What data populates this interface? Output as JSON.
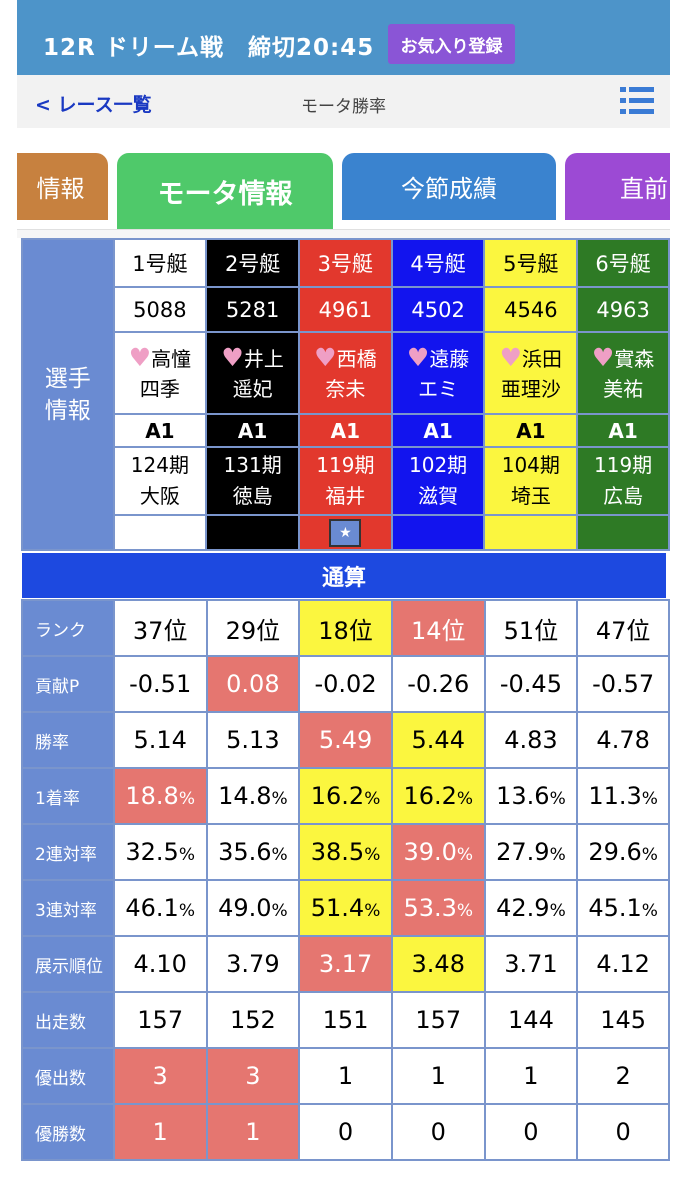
{
  "header": {
    "title": "12R ドリーム戦　締切20:45",
    "favorite_button": "お気入り登録",
    "colors": {
      "bar": "#4d94c9",
      "favorite": "#8a55d6"
    }
  },
  "subnav": {
    "back_label": "< レース一覧",
    "page_title": "モータ勝率",
    "menu_icon": "list-menu-icon"
  },
  "tabs": [
    {
      "label": "情報"
    },
    {
      "label": "モータ情報"
    },
    {
      "label": "今節成績"
    },
    {
      "label": "直前"
    }
  ],
  "player_info": {
    "side_label_1": "選手",
    "side_label_2": "情報",
    "boats": [
      {
        "label": "1号艇",
        "reg": "5088",
        "name1": "高憧",
        "name2": "四季",
        "grade": "A1",
        "term": "124期",
        "branch": "大阪"
      },
      {
        "label": "2号艇",
        "reg": "5281",
        "name1": "井上",
        "name2": "遥妃",
        "grade": "A1",
        "term": "131期",
        "branch": "徳島"
      },
      {
        "label": "3号艇",
        "reg": "4961",
        "name1": "西橋",
        "name2": "奈未",
        "grade": "A1",
        "term": "119期",
        "branch": "福井"
      },
      {
        "label": "4号艇",
        "reg": "4502",
        "name1": "遠藤",
        "name2": "エミ",
        "grade": "A1",
        "term": "102期",
        "branch": "滋賀"
      },
      {
        "label": "5号艇",
        "reg": "4546",
        "name1": "浜田",
        "name2": "亜理沙",
        "grade": "A1",
        "term": "104期",
        "branch": "埼玉"
      },
      {
        "label": "6号艇",
        "reg": "4963",
        "name1": "實森",
        "name2": "美祐",
        "grade": "A1",
        "term": "119期",
        "branch": "広島"
      }
    ],
    "star": "★"
  },
  "total_label": "通算",
  "stats": {
    "labels": [
      "ランク",
      "貢献P",
      "勝率",
      "1着率",
      "2連対率",
      "3連対率",
      "展示順位",
      "出走数",
      "優出数",
      "優勝数"
    ],
    "rows": [
      [
        "37位",
        "29位",
        "18位",
        "14位",
        "51位",
        "47位"
      ],
      [
        "-0.51",
        "0.08",
        "-0.02",
        "-0.26",
        "-0.45",
        "-0.57"
      ],
      [
        "5.14",
        "5.13",
        "5.49",
        "5.44",
        "4.83",
        "4.78"
      ],
      [
        "18.8",
        "14.8",
        "16.2",
        "16.2",
        "13.6",
        "11.3"
      ],
      [
        "32.5",
        "35.6",
        "38.5",
        "39.0",
        "27.9",
        "29.6"
      ],
      [
        "46.1",
        "49.0",
        "51.4",
        "53.3",
        "42.9",
        "45.1"
      ],
      [
        "4.10",
        "3.79",
        "3.17",
        "3.48",
        "3.71",
        "4.12"
      ],
      [
        "157",
        "152",
        "151",
        "157",
        "144",
        "145"
      ],
      [
        "3",
        "3",
        "1",
        "1",
        "1",
        "2"
      ],
      [
        "1",
        "1",
        "0",
        "0",
        "0",
        "0"
      ]
    ],
    "pct_suffix": "%"
  }
}
